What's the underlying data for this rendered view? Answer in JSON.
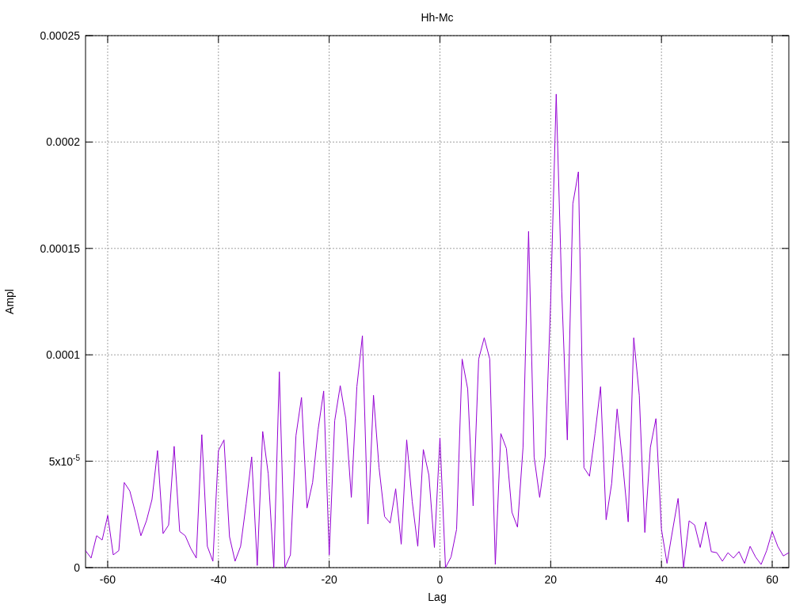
{
  "chart_data": {
    "type": "line",
    "title": "Hh-Mc",
    "xlabel": "Lag",
    "ylabel": "Ampl",
    "grid": true,
    "xlim": [
      -64,
      63
    ],
    "ylim": [
      0,
      0.00025
    ],
    "xticks": [
      -60,
      -40,
      -20,
      0,
      20,
      40,
      60
    ],
    "yticks": [
      {
        "value": 0,
        "label": "0"
      },
      {
        "value": 5e-05,
        "label": "5x10$^{-5}$"
      },
      {
        "value": 0.0001,
        "label": "0.0001"
      },
      {
        "value": 0.00015,
        "label": "0.00015"
      },
      {
        "value": 0.0002,
        "label": "0.0002"
      },
      {
        "value": 0.00025,
        "label": "0.00025"
      }
    ],
    "x": [
      -64,
      -63,
      -62,
      -61,
      -60,
      -59,
      -58,
      -57,
      -56,
      -55,
      -54,
      -53,
      -52,
      -51,
      -50,
      -49,
      -48,
      -47,
      -46,
      -45,
      -44,
      -43,
      -42,
      -41,
      -40,
      -39,
      -38,
      -37,
      -36,
      -35,
      -34,
      -33,
      -32,
      -31,
      -30,
      -29,
      -28,
      -27,
      -26,
      -25,
      -24,
      -23,
      -22,
      -21,
      -20,
      -19,
      -18,
      -17,
      -16,
      -15,
      -14,
      -13,
      -12,
      -11,
      -10,
      -9,
      -8,
      -7,
      -6,
      -5,
      -4,
      -3,
      -2,
      -1,
      0,
      1,
      2,
      3,
      4,
      5,
      6,
      7,
      8,
      9,
      10,
      11,
      12,
      13,
      14,
      15,
      16,
      17,
      18,
      19,
      20,
      21,
      22,
      23,
      24,
      25,
      26,
      27,
      28,
      29,
      30,
      31,
      32,
      33,
      34,
      35,
      36,
      37,
      38,
      39,
      40,
      41,
      42,
      43,
      44,
      45,
      46,
      47,
      48,
      49,
      50,
      51,
      52,
      53,
      54,
      55,
      56,
      57,
      58,
      59,
      60,
      61,
      62,
      63
    ],
    "series": [
      {
        "color": "#9400d3",
        "values": [
          8e-06,
          4.5e-06,
          1.5e-05,
          1.3e-05,
          2.45e-05,
          6e-06,
          8e-06,
          4e-05,
          3.6e-05,
          2.6e-05,
          1.5e-05,
          2.2e-05,
          3.2e-05,
          5.5e-05,
          1.6e-05,
          2e-05,
          5.7e-05,
          1.7e-05,
          1.5e-05,
          9e-06,
          4.5e-06,
          6.25e-05,
          1e-05,
          3e-06,
          5.5e-05,
          6e-05,
          1.45e-05,
          3e-06,
          1e-05,
          3e-05,
          5.2e-05,
          1e-06,
          6.4e-05,
          4.4e-05,
          0,
          9.2e-05,
          0,
          6e-06,
          6.2e-05,
          8e-05,
          2.8e-05,
          4e-05,
          6.5e-05,
          8.3e-05,
          6e-06,
          6.9e-05,
          8.55e-05,
          7e-05,
          3.3e-05,
          8.5e-05,
          0.000109,
          2.05e-05,
          8.1e-05,
          4.7e-05,
          2.4e-05,
          2.1e-05,
          3.7e-05,
          1.1e-05,
          6e-05,
          3.1e-05,
          1e-05,
          5.55e-05,
          4.35e-05,
          9.5e-06,
          6.1e-05,
          0,
          5e-06,
          1.8e-05,
          9.8e-05,
          8.4e-05,
          2.9e-05,
          9.8e-05,
          0.000108,
          9.8e-05,
          1.5e-06,
          6.3e-05,
          5.6e-05,
          2.6e-05,
          1.9e-05,
          5.65e-05,
          0.000158,
          5.2e-05,
          3.3e-05,
          5.2e-05,
          0.000125,
          0.0002225,
          0.0001295,
          6e-05,
          0.000171,
          0.000186,
          4.7e-05,
          4.3e-05,
          6.3e-05,
          8.5e-05,
          2.25e-05,
          3.95e-05,
          7.45e-05,
          4.9e-05,
          2.15e-05,
          0.000108,
          8.1e-05,
          1.65e-05,
          5.65e-05,
          7e-05,
          1.8e-05,
          2e-06,
          1.75e-05,
          3.25e-05,
          0,
          2.2e-05,
          2e-05,
          9.5e-06,
          2.15e-05,
          7.5e-06,
          7e-06,
          3e-06,
          7e-06,
          4.5e-06,
          7.5e-06,
          2e-06,
          1e-05,
          5e-06,
          1.5e-06,
          8e-06,
          1.7e-05,
          1e-05,
          5.5e-06,
          7e-06
        ]
      }
    ]
  }
}
